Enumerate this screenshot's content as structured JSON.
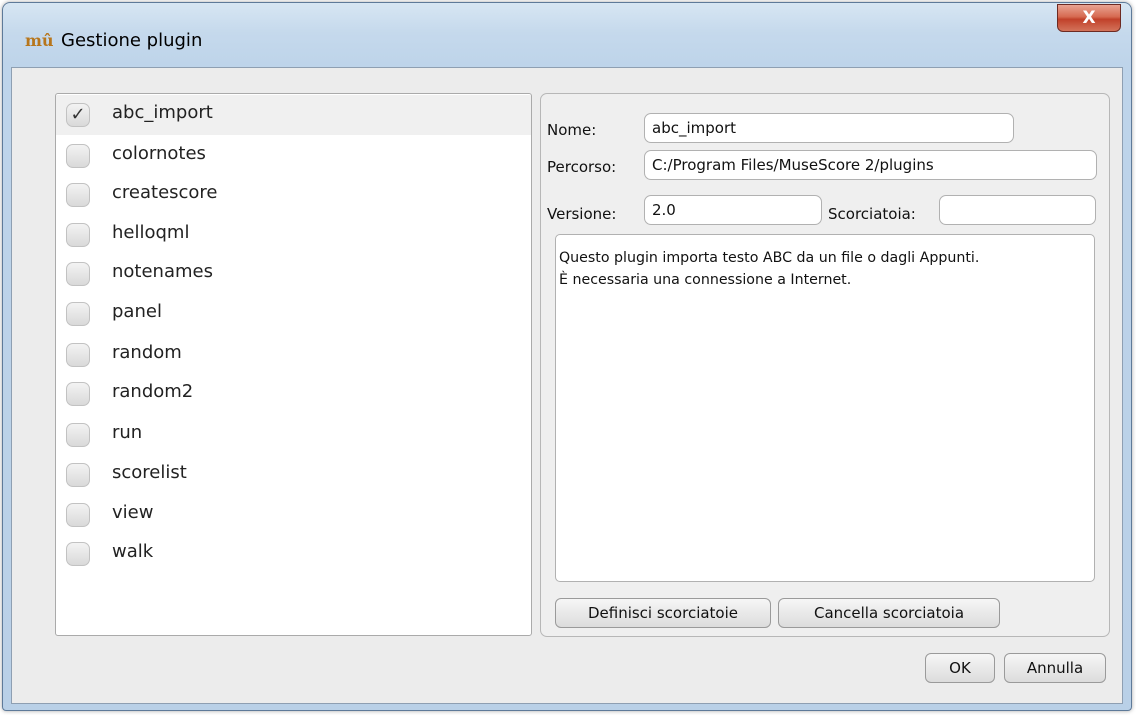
{
  "window": {
    "title": "Gestione plugin",
    "app_icon_glyph": "mû",
    "close_glyph": "X"
  },
  "plugins": [
    {
      "name": "abc_import",
      "enabled": true
    },
    {
      "name": "colornotes",
      "enabled": false
    },
    {
      "name": "createscore",
      "enabled": false
    },
    {
      "name": "helloqml",
      "enabled": false
    },
    {
      "name": "notenames",
      "enabled": false
    },
    {
      "name": "panel",
      "enabled": false
    },
    {
      "name": "random",
      "enabled": false
    },
    {
      "name": "random2",
      "enabled": false
    },
    {
      "name": "run",
      "enabled": false
    },
    {
      "name": "scorelist",
      "enabled": false
    },
    {
      "name": "view",
      "enabled": false
    },
    {
      "name": "walk",
      "enabled": false
    }
  ],
  "details": {
    "name_label": "Nome:",
    "name_value": "abc_import",
    "path_label": "Percorso:",
    "path_value": "C:/Program Files/MuseScore 2/plugins",
    "version_label": "Versione:",
    "version_value": "2.0",
    "shortcut_label": "Scorciatoia:",
    "shortcut_value": "",
    "description_line1": "Questo plugin importa testo ABC da un file o dagli Appunti.",
    "description_line2": "È necessaria una connessione a Internet."
  },
  "buttons": {
    "define_shortcuts": "Definisci scorciatoie",
    "clear_shortcut": "Cancella scorciatoia",
    "ok": "OK",
    "cancel": "Annulla"
  },
  "icons": {
    "check_glyph": "✓"
  }
}
